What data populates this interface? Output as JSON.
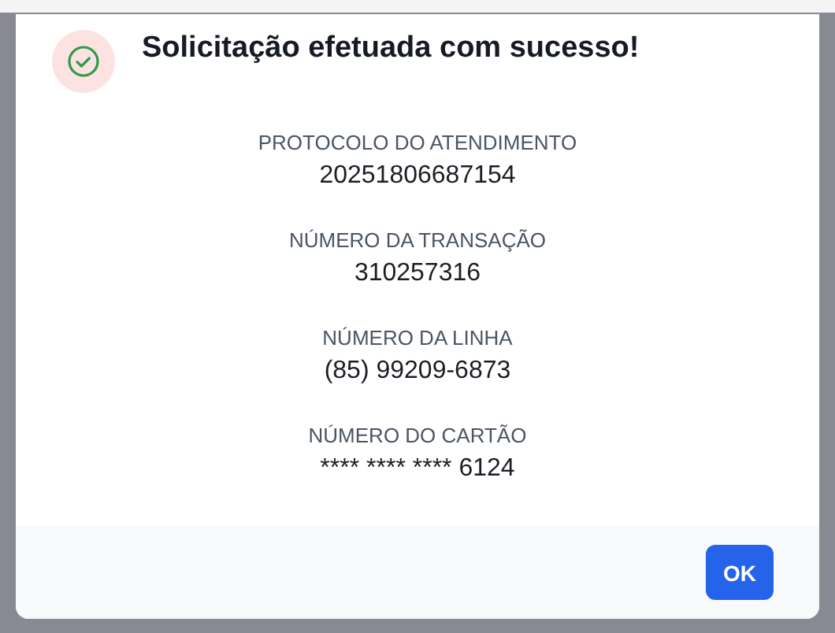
{
  "dialog": {
    "title": "Solicitação efetuada com sucesso!",
    "fields": [
      {
        "label": "PROTOCOLO DO ATENDIMENTO",
        "value": "20251806687154"
      },
      {
        "label": "NÚMERO DA TRANSAÇÃO",
        "value": "310257316"
      },
      {
        "label": "NÚMERO DA LINHA",
        "value": "(85) 99209-6873"
      },
      {
        "label": "NÚMERO DO CARTÃO",
        "value": "**** **** **** 6124"
      }
    ],
    "button": "OK"
  }
}
